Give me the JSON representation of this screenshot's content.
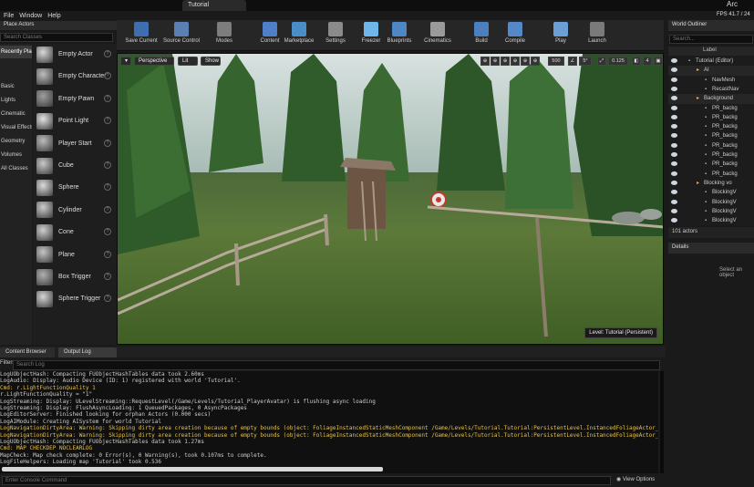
{
  "window": {
    "tab": "Tutorial",
    "app_name": "Arc",
    "fps_label": "FPS",
    "fps_value": "41.7",
    "frame_ms": "24"
  },
  "menu": [
    "File",
    "Window",
    "Help"
  ],
  "toolbar": [
    {
      "label": "Save Current",
      "icon": "save-icon",
      "color": "#3d6fb0"
    },
    {
      "label": "Source Control",
      "icon": "source-control-icon",
      "color": "#5a7fb5"
    },
    {
      "label": "Modes",
      "icon": "modes-icon",
      "color": "#7d7d7d"
    },
    {
      "label": "Content",
      "icon": "content-icon",
      "color": "#4e7fc7"
    },
    {
      "label": "Marketplace",
      "icon": "marketplace-icon",
      "color": "#4a8ec8"
    },
    {
      "label": "Settings",
      "icon": "settings-gear-icon",
      "color": "#8a8a8a"
    },
    {
      "label": "Freezer",
      "icon": "freezer-snowflake-icon",
      "color": "#6fb6ea"
    },
    {
      "label": "Blueprints",
      "icon": "blueprints-icon",
      "color": "#4f86c4"
    },
    {
      "label": "Cinematics",
      "icon": "cinematics-clapper-icon",
      "color": "#9a9a9a"
    },
    {
      "label": "Build",
      "icon": "build-icon",
      "color": "#4a7fc0"
    },
    {
      "label": "Compile",
      "icon": "compile-icon",
      "color": "#5588c8"
    },
    {
      "label": "Play",
      "icon": "play-icon",
      "color": "#6c9fd6"
    },
    {
      "label": "Launch",
      "icon": "launch-icon",
      "color": "#7a7a7a"
    }
  ],
  "place_actors": {
    "header": "Place Actors",
    "search_placeholder": "Search Classes",
    "categories": [
      "Recently Placed",
      "Basic",
      "Lights",
      "Cinematic",
      "Visual Effects",
      "Geometry",
      "Volumes",
      "All Classes"
    ],
    "selected_category": "Recently Placed",
    "items": [
      "Empty Actor",
      "Empty Character",
      "Empty Pawn",
      "Point Light",
      "Player Start",
      "Cube",
      "Sphere",
      "Cylinder",
      "Cone",
      "Plane",
      "Box Trigger",
      "Sphere Trigger"
    ]
  },
  "viewport": {
    "perspective": "Perspective",
    "lit": "Lit",
    "show": "Show",
    "grid_size": "500",
    "angle": "5°",
    "scale": "0.125",
    "camera_speed": "4",
    "level_label": "Level:",
    "level_name": "Tutorial (Persistent)"
  },
  "world_outliner": {
    "header": "World Outliner",
    "search_placeholder": "Search...",
    "column": "Label",
    "rows": [
      {
        "label": "Tutorial (Editor)",
        "indent": 2
      },
      {
        "label": "AI",
        "indent": 3
      },
      {
        "label": "NavMesh",
        "indent": 4
      },
      {
        "label": "RecastNav",
        "indent": 4
      },
      {
        "label": "Background",
        "indent": 3
      },
      {
        "label": "PR_backg",
        "indent": 4
      },
      {
        "label": "PR_backg",
        "indent": 4
      },
      {
        "label": "PR_backg",
        "indent": 4
      },
      {
        "label": "PR_backg",
        "indent": 4
      },
      {
        "label": "PR_backg",
        "indent": 4
      },
      {
        "label": "PR_backg",
        "indent": 4
      },
      {
        "label": "PR_backg",
        "indent": 4
      },
      {
        "label": "PR_backg",
        "indent": 4
      },
      {
        "label": "Blocking vo",
        "indent": 3
      },
      {
        "label": "BlockingV",
        "indent": 4
      },
      {
        "label": "BlockingV",
        "indent": 4
      },
      {
        "label": "BlockingV",
        "indent": 4
      },
      {
        "label": "BlockingV",
        "indent": 4
      }
    ],
    "count": "101 actors"
  },
  "details": {
    "header": "Details",
    "empty_text": "Select an object"
  },
  "log": {
    "tabs": [
      "Content Browser",
      "Output Log"
    ],
    "filter_label": "Filters",
    "search_placeholder": "Search Log",
    "lines": [
      {
        "text": "LogUObjectHash: Compacting FUObjectHashTables data took   2.60ms",
        "warn": false
      },
      {
        "text": "LogAudio: Display: Audio Device (ID: 1) registered with world 'Tutorial'.",
        "warn": false
      },
      {
        "text": "Cmd: r.LightFunctionQuality 1",
        "warn": true
      },
      {
        "text": "r.LightFunctionQuality = \"1\"",
        "warn": false
      },
      {
        "text": "LogStreaming: Display: ULevelStreaming::RequestLevel(/Game/Levels/Tutorial_PlayerAvatar) is flushing async loading",
        "warn": false
      },
      {
        "text": "LogStreaming: Display: FlushAsyncLoading: 1 QueuedPackages, 0 AsyncPackages",
        "warn": false
      },
      {
        "text": "LogEditorServer: Finished looking for orphan Actors (0.000 secs)",
        "warn": false
      },
      {
        "text": "LogAIModule: Creating AISystem for world Tutorial",
        "warn": false
      },
      {
        "text": "LogNavigationDirtyArea: Warning: Skipping dirty area creation because of empty bounds (object: FoliageInstancedStaticMeshComponent /Game/Levels/Tutorial.Tutorial:PersistentLevel.InstancedFoliageActor_0.FoliageIn",
        "warn": true
      },
      {
        "text": "LogNavigationDirtyArea: Warning: Skipping dirty area creation because of empty bounds (object: FoliageInstancedStaticMeshComponent /Game/Levels/Tutorial.Tutorial:PersistentLevel.InstancedFoliageActor_0.FoliageIn",
        "warn": true
      },
      {
        "text": "LogUObjectHash: Compacting FUObjectHashTables data took   1.27ms",
        "warn": false
      },
      {
        "text": "Cmd: MAP CHECKDEP NOCLEARLOG",
        "warn": true
      },
      {
        "text": "MapCheck: Map check complete: 0 Error(s), 0 Warning(s), took 0.107ms to complete.",
        "warn": false
      },
      {
        "text": "LogFileHelpers: Loading map 'Tutorial' took 0.536",
        "warn": false
      }
    ],
    "console_placeholder": "Enter Console Command",
    "view_options": "View Options"
  }
}
